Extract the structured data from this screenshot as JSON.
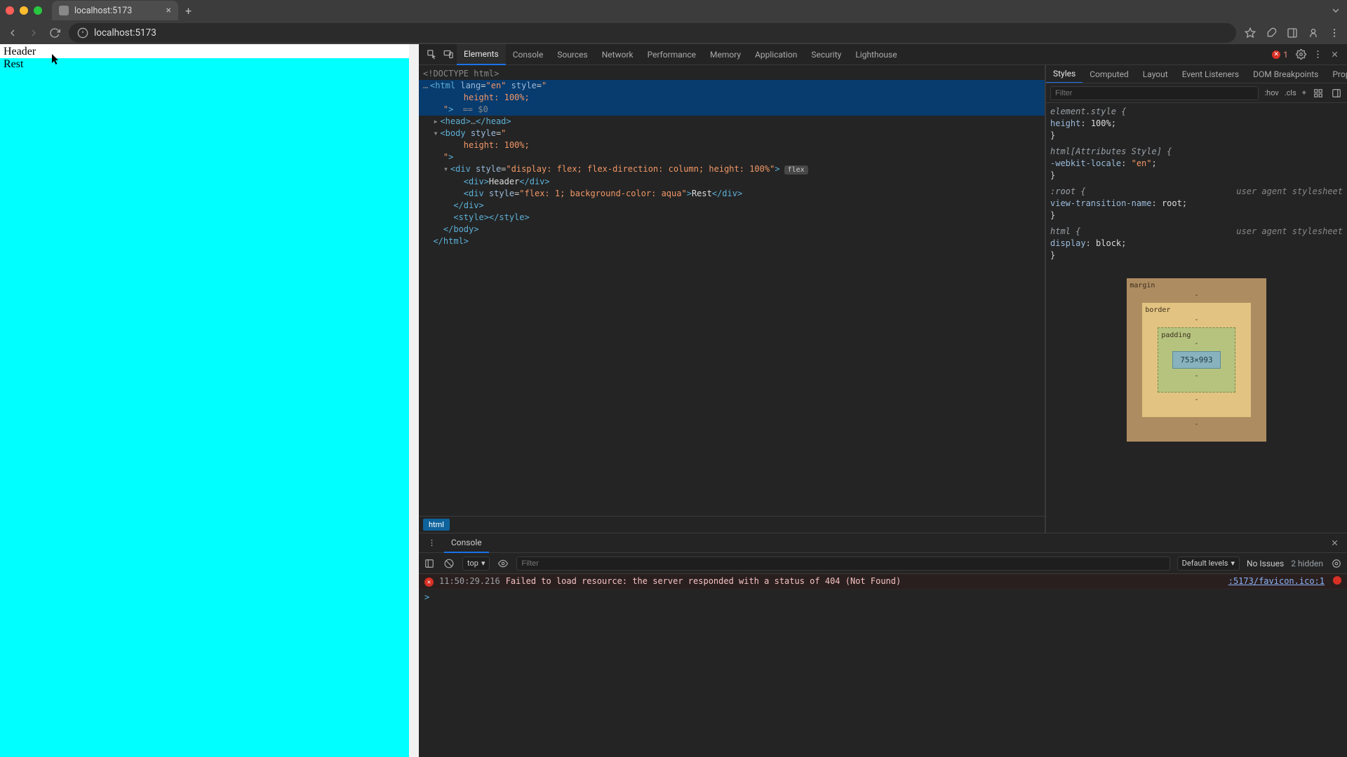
{
  "browser": {
    "tab_title": "localhost:5173",
    "url": "localhost:5173"
  },
  "page": {
    "header_text": "Header",
    "rest_text": "Rest"
  },
  "devtools": {
    "tabs": [
      "Elements",
      "Console",
      "Sources",
      "Network",
      "Performance",
      "Memory",
      "Application",
      "Security",
      "Lighthouse"
    ],
    "active_tab": "Elements",
    "error_count": "1",
    "styles_tabs": [
      "Styles",
      "Computed",
      "Layout",
      "Event Listeners",
      "DOM Breakpoints",
      "Properties"
    ],
    "styles_active": "Styles",
    "filter_placeholder": "Filter",
    "hov": ":hov",
    "cls": ".cls",
    "dom": {
      "doctype": "<!DOCTYPE html>",
      "html_open": "<html lang=\"en\" style=\"",
      "html_prop": "        height: 100%;",
      "html_close_attr": "\">",
      "eq0": " == $0",
      "head": "<head>…</head>",
      "body_open": "<body style=\"",
      "body_prop": "        height: 100%;",
      "body_close_attr": "\">",
      "flex_open": "<div style=\"display: flex; flex-direction: column; height: 100%\">",
      "header_div": "<div>Header</div>",
      "rest_div": "<div style=\"flex: 1; background-color: aqua\">Rest</div>",
      "div_close": "</div>",
      "style_tag": "<style></style>",
      "body_close": "</body>",
      "html_close": "</html>"
    },
    "crumb": "html",
    "styles": {
      "element_style_sel": "element.style {",
      "element_style_prop": "  height: 100%;",
      "close": "}",
      "attr_style_sel": "html[Attributes Style] {",
      "attr_style_prop": "  -webkit-locale: \"en\";",
      "root_sel": ":root {",
      "root_prop": "  view-transition-name: root;",
      "html_sel": "html {",
      "html_prop": "  display: block;",
      "ua_label": "user agent stylesheet"
    },
    "box_model": {
      "margin": "margin",
      "border": "border",
      "padding": "padding",
      "content": "753×993"
    }
  },
  "console": {
    "drawer_tab": "Console",
    "context": "top",
    "filter_placeholder": "Filter",
    "levels": "Default levels",
    "issues": "No Issues",
    "hidden": "2 hidden",
    "timestamp": "11:50:29.216",
    "message": "Failed to load resource: the server responded with a status of 404 (Not Found)",
    "source": ":5173/favicon.ico:1",
    "prompt": ">"
  }
}
